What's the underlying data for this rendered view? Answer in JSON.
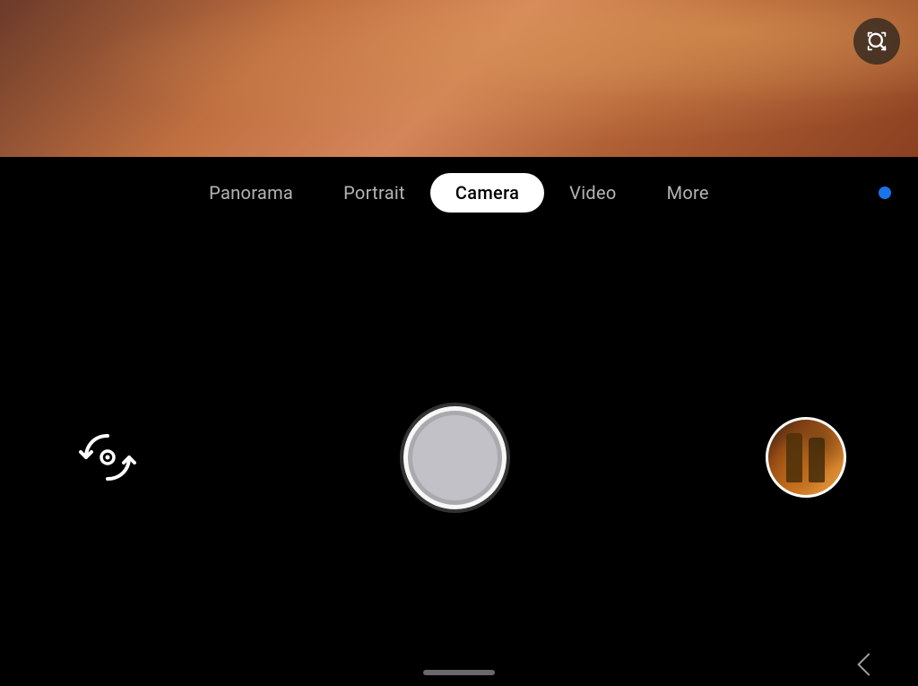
{
  "viewfinder": {
    "alt": "Camera viewfinder showing blurred warm tones"
  },
  "lens_button": {
    "label": "Google Lens",
    "icon": "lens-search-icon"
  },
  "mode_bar": {
    "modes": [
      {
        "id": "panorama",
        "label": "Panorama",
        "active": false
      },
      {
        "id": "portrait",
        "label": "Portrait",
        "active": false
      },
      {
        "id": "camera",
        "label": "Camera",
        "active": true
      },
      {
        "id": "video",
        "label": "Video",
        "active": false
      },
      {
        "id": "more",
        "label": "More",
        "active": false
      }
    ],
    "notification_dot_color": "#1a73e8"
  },
  "controls": {
    "flip_camera_label": "Flip camera",
    "shutter_label": "Take photo",
    "gallery_label": "Open gallery"
  },
  "bottom_nav": {
    "home_indicator": "Home indicator",
    "back_button": "Back"
  }
}
